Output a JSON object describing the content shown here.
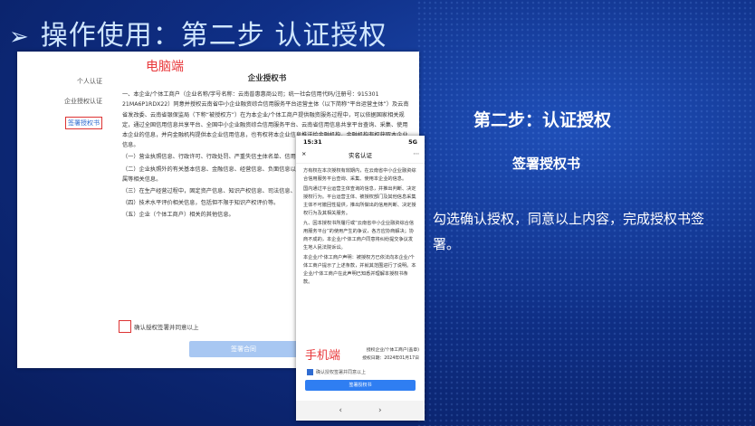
{
  "slide": {
    "title": "操作使用：第二步 认证授权"
  },
  "desktop": {
    "label": "电脑端",
    "steps": [
      "个人认证",
      "企业授权认证",
      "签署授权书"
    ],
    "doc_title": "企业授权书",
    "paragraphs": [
      "一、本企业/个体工商户（企业名称/字号名称：云南普惠惠商公司；统一社会信用代码/注册号：915301 21MA6P1RDX22）同意并授权云南省中小企业融资综合信用服务平台运营主体（以下简称“平台运营主体”）及云南省发改委、云南省银保监局（下称“被授权方”）在为本企业/个体工商户提供融资服务过程中，可以依据国家相关规定，通过全国信用信息共享平台、全国中小企业融资综合信用服务平台、云南省信用信息共享平台查询、采集、使用本企业的信息，并向金融机构提供本企业信用信息，也有权将本企业信息推送给金融机构，金融机构有权获取本企业信息。",
      "（一）营业执照信息、行政许可、行政处罚、严重失信主体名单、信用承诺等信用信息。",
      "（二）企业执照外的有关基本信息、金融信息、经营信息、负面信息以及股东、实际控制人、法定代表人员与集团下属等相关信息。",
      "（三）在生产经营过程中，固定资产信息、知识产权信息、司法信息、环境信息等。",
      "（四）技术水平评价相关信息，包括但不限于知识产权评价等。",
      "（五）企业（个体工商户）相关的其他信息。"
    ],
    "consent": "确认授权签署并同意以上",
    "sign_button": "签署合同"
  },
  "mobile": {
    "label": "手机端",
    "time": "15:31",
    "signal": "5G",
    "nav_title": "实名认证",
    "close_icon": "×",
    "more_icon": "⋯",
    "paragraphs": [
      "方有权在本次授权有效期内，在云南省中小企业融资综合信用服务平台查询、采集、使用本企业的信息。",
      "国内通过平台运营主体查询的信息，并推出判断、决定授权行为。平台运营主体、被授权部门及其他信息采集主体不可撤回性提供，推出所做出的信用判断、决定授权行为及其相关服务。",
      "九、因本授权书所履行或“云南省中小企业融资综合信用服务平台”的使用产生的争议，各方应协商解决；协商不成的，本企业/个体工商户同意将纠纷提交争议发生地人民法院诉讼。",
      "本企业/个体工商户声明：被授权方已依法向本企业/个体工商户提示了上述条款，并就其范围进行了说明。本企业/个体工商户在此声明已知悉并理解本授权书条款。"
    ],
    "signature": "授权企业/个体工商户(盖章)",
    "sign_date": "授权日期：2024年01月17日",
    "consent": "确认授权签署并同意以上",
    "sign_button": "签署授权书",
    "back_icon": "‹",
    "forward_icon": "›"
  },
  "right": {
    "h1": "第二步：认证授权",
    "h2": "签署授权书",
    "desc": "勾选确认授权，同意以上内容，完成授权书签署。"
  }
}
